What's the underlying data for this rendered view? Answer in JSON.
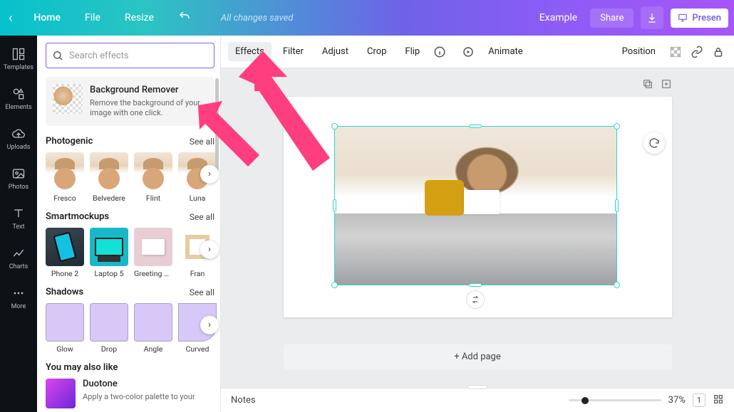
{
  "topbar": {
    "home": "Home",
    "file": "File",
    "resize": "Resize",
    "status": "All changes saved",
    "example": "Example",
    "share": "Share",
    "present": "Presen"
  },
  "rail": {
    "templates": "Templates",
    "elements": "Elements",
    "uploads": "Uploads",
    "photos": "Photos",
    "text": "Text",
    "charts": "Charts",
    "more": "More"
  },
  "panel": {
    "search_placeholder": "Search effects",
    "bg_remover": {
      "title": "Background Remover",
      "desc": "Remove the background of your image with one click."
    },
    "photogenic": {
      "title": "Photogenic",
      "see_all": "See all",
      "items": [
        "Fresco",
        "Belvedere",
        "Flint",
        "Luna"
      ]
    },
    "smartmockups": {
      "title": "Smartmockups",
      "see_all": "See all",
      "items": [
        "Phone 2",
        "Laptop 5",
        "Greeting car...",
        "Fran"
      ]
    },
    "shadows": {
      "title": "Shadows",
      "see_all": "See all",
      "items": [
        "Glow",
        "Drop",
        "Angle",
        "Curved"
      ]
    },
    "also_like": {
      "title": "You may also like"
    },
    "duotone": {
      "title": "Duotone",
      "desc": "Apply a two-color palette to your"
    }
  },
  "toolbar": {
    "effects": "Effects",
    "filter": "Filter",
    "adjust": "Adjust",
    "crop": "Crop",
    "flip": "Flip",
    "animate": "Animate",
    "position": "Position"
  },
  "canvas": {
    "add_page": "+ Add page"
  },
  "notes": {
    "label": "Notes",
    "zoom": "37%",
    "page": "1"
  }
}
